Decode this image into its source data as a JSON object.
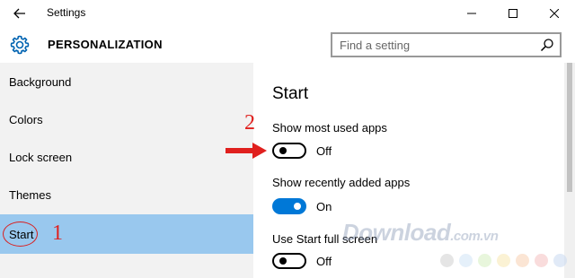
{
  "window": {
    "title": "Settings",
    "back_icon": "back-arrow-icon",
    "controls": [
      "minimize-icon",
      "maximize-icon",
      "close-icon"
    ]
  },
  "header": {
    "section_title": "PERSONALIZATION",
    "icon": "gear-icon",
    "search_placeholder": "Find a setting"
  },
  "sidebar": {
    "items": [
      {
        "label": "Background",
        "selected": false
      },
      {
        "label": "Colors",
        "selected": false
      },
      {
        "label": "Lock screen",
        "selected": false
      },
      {
        "label": "Themes",
        "selected": false
      },
      {
        "label": "Start",
        "selected": true
      }
    ]
  },
  "content": {
    "page_title": "Start",
    "settings": [
      {
        "label": "Show most used apps",
        "state": "Off"
      },
      {
        "label": "Show recently added apps",
        "state": "On"
      },
      {
        "label": "Use Start full screen",
        "state": "Off"
      }
    ]
  },
  "annotations": {
    "step1": "1",
    "step2": "2",
    "color": "#e0201e"
  },
  "watermark": {
    "text": "Download",
    "suffix": ".com.vn",
    "dot_colors": [
      "#d0d0d0",
      "#cfe3f5",
      "#d6eec0",
      "#f8e8b0",
      "#f8d0b0",
      "#f4c0c0",
      "#c8d8f0"
    ]
  },
  "colors": {
    "accent": "#0078d7",
    "selected_bg": "#99c8ee",
    "sidebar_bg": "#f2f2f2"
  }
}
